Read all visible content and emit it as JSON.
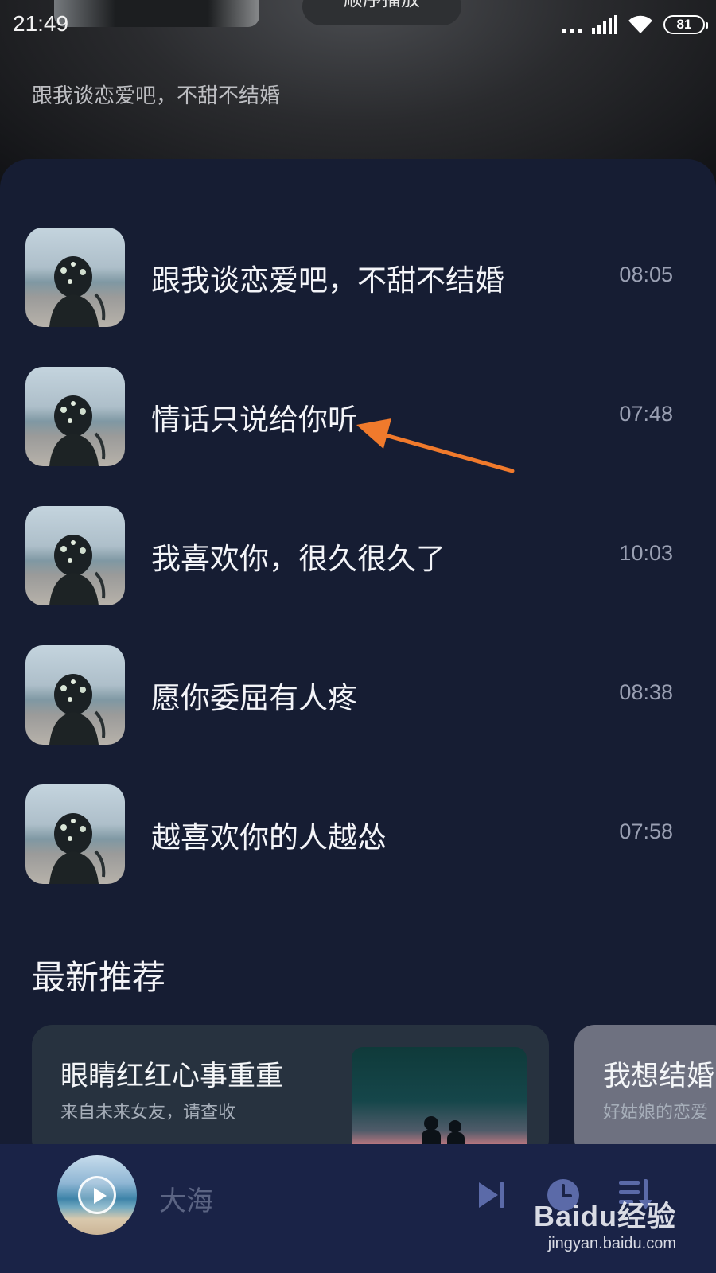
{
  "status_bar": {
    "time": "21:49",
    "battery": "81"
  },
  "header": {
    "play_mode": "顺序播放",
    "subtitle": "跟我谈恋爱吧，不甜不结婚"
  },
  "tracks": [
    {
      "title": "跟我谈恋爱吧，不甜不结婚",
      "duration": "08:05"
    },
    {
      "title": "情话只说给你听",
      "duration": "07:48"
    },
    {
      "title": "我喜欢你，很久很久了",
      "duration": "10:03"
    },
    {
      "title": "愿你委屈有人疼",
      "duration": "08:38"
    },
    {
      "title": "越喜欢你的人越怂",
      "duration": "07:58"
    }
  ],
  "annotation": {
    "color": "#f07a2c"
  },
  "recommend": {
    "heading": "最新推荐",
    "cards": [
      {
        "title": "眼睛红红心事重重",
        "subtitle": "来自未来女友，请查收"
      },
      {
        "title": "我想结婚",
        "subtitle": "好姑娘的恋爱"
      }
    ]
  },
  "now_playing": {
    "title": "大海",
    "icons": [
      "play-icon",
      "next-track-icon",
      "timer-icon",
      "playlist-icon"
    ]
  },
  "watermark": {
    "logo": "Baidu经验",
    "url": "jingyan.baidu.com"
  },
  "colors": {
    "panel_bg": "#161d33",
    "bottom_bar_bg": "#1a2347",
    "accent_icon": "#5b6aa8"
  }
}
